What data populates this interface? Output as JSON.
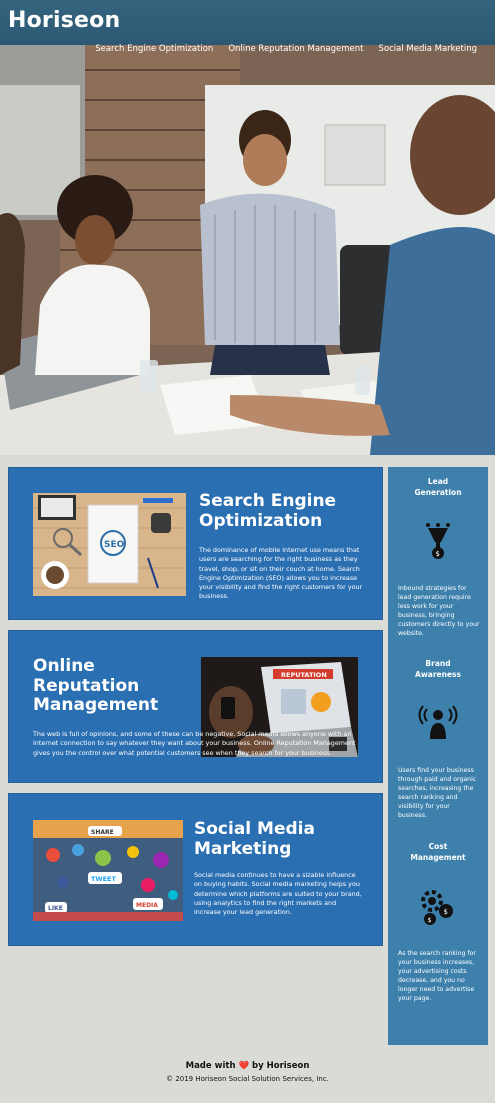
{
  "header": {
    "logo": "Horiseon",
    "nav": [
      "Search Engine Optimization",
      "Online Reputation Management",
      "Social Media Marketing"
    ]
  },
  "sections": {
    "seo": {
      "title": "Search Engine Optimization",
      "text": "The dominance of mobile internet use means that users are searching for the right business as they travel, shop, or sit on their couch at home. Search Engine Optimization (SEO) allows you to increase your visibility and find the right customers for your business.",
      "image_label": "SEO"
    },
    "orm": {
      "title": "Online Reputation Management",
      "text": "The web is full of opinions, and some of these can be negative. Social media allows anyone with an internet connection to say whatever they want about your business. Online Reputation Management gives you the control over what potential customers see when they search for your business.",
      "image_label": "REPUTATION"
    },
    "smm": {
      "title": "Social Media Marketing",
      "text": "Social media continues to have a sizable influence on buying habits. Social media marketing helps you determine which platforms are suited to your brand, using analytics to find the right markets and increase your lead generation.",
      "image_labels": [
        "SHARE",
        "TWEET",
        "MEDIA",
        "LIKE"
      ]
    }
  },
  "sidebar": {
    "lead": {
      "title": "Lead Generation",
      "text": "Inbound strategies for lead generation require less work for your business, bringing customers directly to your website."
    },
    "brand": {
      "title": "Brand Awareness",
      "text": "Users find your business through paid and organic searches, increasing the search ranking and visibility for your business."
    },
    "cost": {
      "title": "Cost Management",
      "text": "As the search ranking for your business increases, your advertising costs decrease, and you no longer need to advertise your page."
    }
  },
  "footer": {
    "made_prefix": "Made with",
    "heart": "❤️",
    "made_suffix": "by Horiseon",
    "copyright": "© 2019 Horiseon Social Solution Services, Inc."
  },
  "colors": {
    "header": "#2c5873",
    "card": "#2b6fb3",
    "sidebar": "#3d80ac",
    "background": "#d9dcd6"
  }
}
